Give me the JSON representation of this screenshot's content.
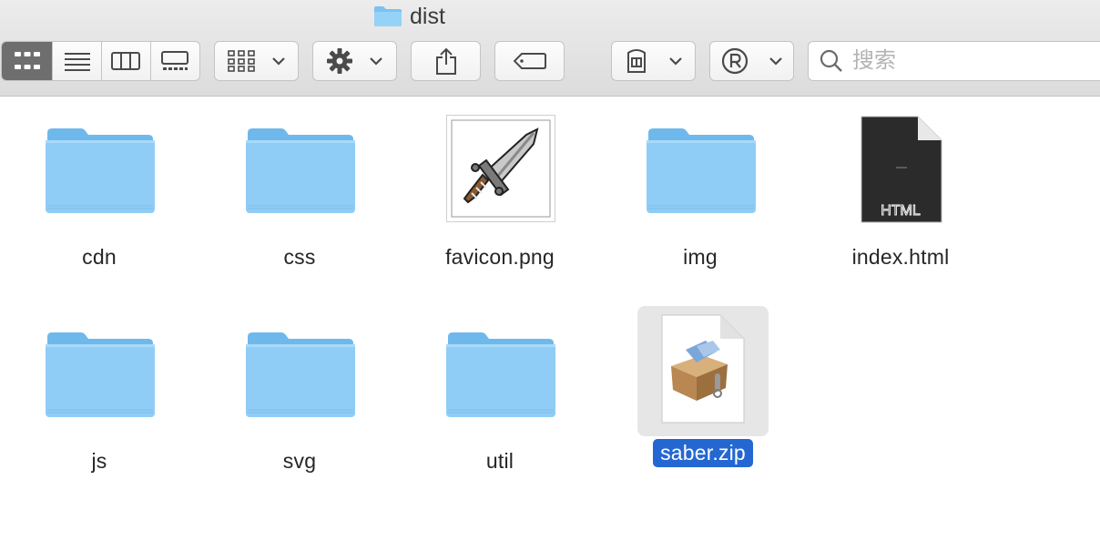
{
  "window": {
    "title": "dist",
    "title_icon": "folder-icon"
  },
  "toolbar": {
    "view_modes": [
      {
        "name": "icon-view",
        "icon": "grid-icon",
        "active": true
      },
      {
        "name": "list-view",
        "icon": "list-icon",
        "active": false
      },
      {
        "name": "column-view",
        "icon": "columns-icon",
        "active": false
      },
      {
        "name": "gallery-view",
        "icon": "gallery-icon",
        "active": false
      }
    ],
    "group_button_icon": "group-grid-icon",
    "action_button_icon": "gear-icon",
    "share_button_icon": "share-icon",
    "tag_button_icon": "tag-icon",
    "ext_button_1_icon": "archive-tool-icon",
    "ext_button_2_icon": "registered-r-icon",
    "search": {
      "placeholder": "搜索",
      "value": ""
    }
  },
  "files": [
    {
      "name": "cdn",
      "kind": "folder"
    },
    {
      "name": "css",
      "kind": "folder"
    },
    {
      "name": "favicon.png",
      "kind": "image-sword"
    },
    {
      "name": "img",
      "kind": "folder"
    },
    {
      "name": "index.html",
      "kind": "html-document",
      "badge": "HTML"
    },
    {
      "name": "js",
      "kind": "folder"
    },
    {
      "name": "svg",
      "kind": "folder"
    },
    {
      "name": "util",
      "kind": "folder"
    },
    {
      "name": "saber.zip",
      "kind": "zip-archive",
      "selected": true
    }
  ],
  "colors": {
    "folder": "#8fcdf6",
    "selection": "#2467d2",
    "selection_box": "#e6e6e6",
    "toolbar": "#e0e0e0"
  }
}
